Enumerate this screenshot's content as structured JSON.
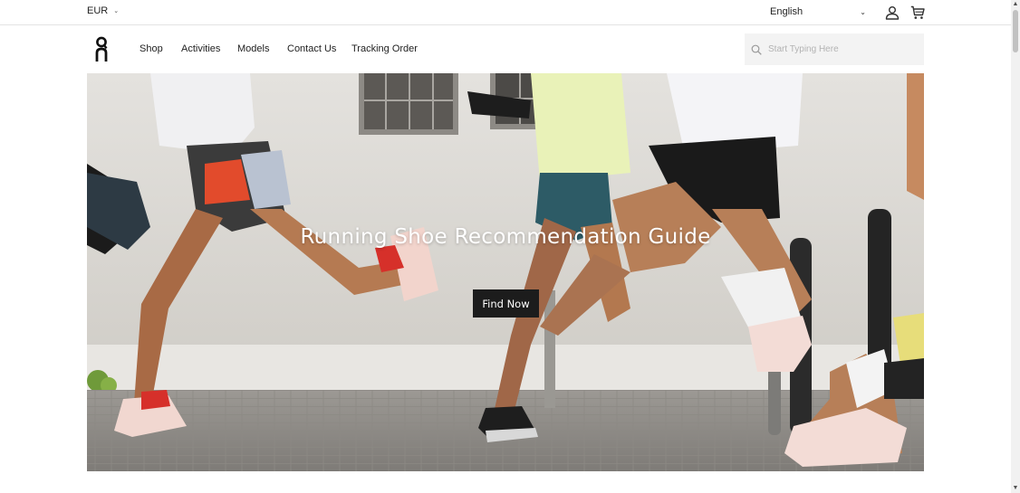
{
  "topbar": {
    "currency": "EUR",
    "language": "English",
    "user_icon": "user-icon",
    "cart_icon": "cart-icon"
  },
  "nav": {
    "logo_icon": "on-logo-icon",
    "items": [
      {
        "label": "Shop"
      },
      {
        "label": "Activities"
      },
      {
        "label": "Models"
      },
      {
        "label": "Contact Us"
      },
      {
        "label": "Tracking Order"
      }
    ],
    "search": {
      "placeholder": "Start Typing Here",
      "value": ""
    }
  },
  "hero": {
    "title": "Running Shoe Recommendation Guide",
    "button_label": "Find Now"
  },
  "colors": {
    "text": "#222222",
    "button_bg": "#1c1c1c",
    "search_bg": "#f3f3f3",
    "hero_wall": "#d9d6d1"
  }
}
